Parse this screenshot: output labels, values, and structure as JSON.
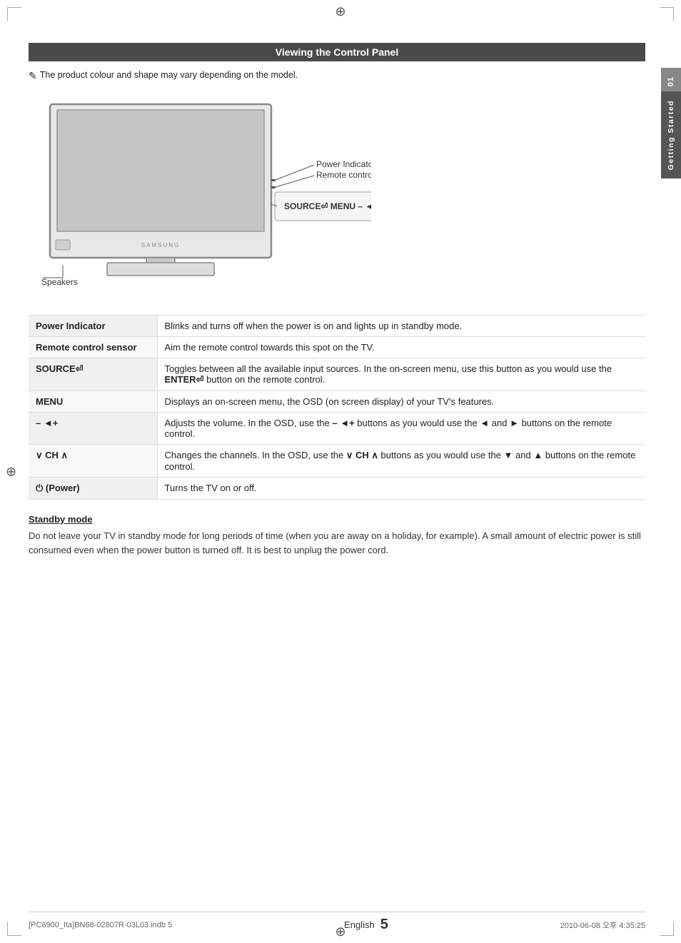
{
  "page": {
    "title": "Viewing the Control Panel",
    "note": "The product colour and shape may vary depending on the model.",
    "note_icon": "✎",
    "tv": {
      "brand": "SAMSUNG",
      "speakers_label": "Speakers",
      "power_indicator_label": "Power Indicator",
      "remote_sensor_label": "Remote control sensor"
    },
    "control_panel_buttons": "SOURCE⏎  MENU  –  ◄+   ∨ CH ∧   ⏻",
    "table": {
      "rows": [
        {
          "key": "Power Indicator",
          "value": "Blinks and turns off when the power is on and lights up in standby mode."
        },
        {
          "key": "Remote control sensor",
          "value": "Aim the remote control towards this spot on the TV."
        },
        {
          "key": "SOURCE⏎",
          "value": "Toggles between all the available input sources. In the on-screen menu, use this button as you would use the ENTER⏎ button on the remote control."
        },
        {
          "key": "MENU",
          "value": "Displays an on-screen menu, the OSD (on screen display) of your TV's features."
        },
        {
          "key": "– ◄+",
          "value": "Adjusts the volume. In the OSD, use the – ◄+ buttons as you would use the ◄ and ► buttons on the remote control."
        },
        {
          "key": "∨ CH ∧",
          "value": "Changes the channels. In the OSD, use the ∨ CH ∧ buttons as you would use the ▼ and ▲ buttons on the remote control."
        },
        {
          "key": "⏻ (Power)",
          "value": "Turns the TV on or off."
        }
      ]
    },
    "standby": {
      "title": "Standby mode",
      "text": "Do not leave your TV in standby mode for long periods of time (when you are away on a holiday, for example). A small amount of electric power is still consumed even when the power button is turned off. It is best to unplug the power cord."
    },
    "footer": {
      "file_info": "[PC6900_Ita]BN68-02807R-03L03.indb   5",
      "date": "2010-06-08   오후 4:35:25",
      "language": "English",
      "page_number": "5"
    },
    "sidebar": {
      "number": "01",
      "text": "Getting Started"
    }
  }
}
